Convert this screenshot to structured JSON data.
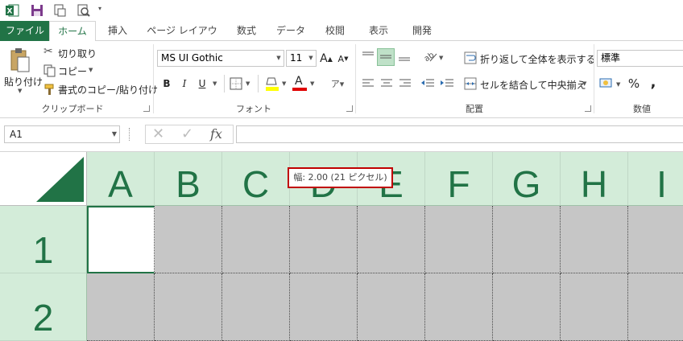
{
  "tabs": [
    "ファイル",
    "ホーム",
    "挿入",
    "ページ レイアウト",
    "数式",
    "データ",
    "校閲",
    "表示",
    "開発"
  ],
  "clipboard": {
    "paste": "貼り付け",
    "cut": "切り取り",
    "copy": "コピー",
    "format_painter": "書式のコピー/貼り付け",
    "group": "クリップボード"
  },
  "font": {
    "name": "MS UI Gothic",
    "size": "11",
    "bold": "B",
    "italic": "I",
    "underline": "U",
    "grow": "A",
    "shrink": "A",
    "font_color_letter": "A",
    "group": "フォント"
  },
  "alignment": {
    "wrap_text": "折り返して全体を表示する",
    "merge_center": "セルを結合して中央揃え",
    "group": "配置"
  },
  "number": {
    "format": "標準",
    "percent": "%",
    "comma": ",",
    "group": "数値"
  },
  "formula_bar": {
    "name_box": "A1",
    "fx": "fx",
    "value": ""
  },
  "columns": [
    "A",
    "B",
    "C",
    "D",
    "E",
    "F",
    "G",
    "H",
    "I"
  ],
  "rows": [
    "1",
    "2"
  ],
  "tooltip": "幅: 2.00 (21 ピクセル)",
  "colors": {
    "accent": "#217346",
    "header_bg": "#d3ecd9",
    "cell_fill": "#c6c6c6",
    "tooltip_border": "#c00000"
  }
}
